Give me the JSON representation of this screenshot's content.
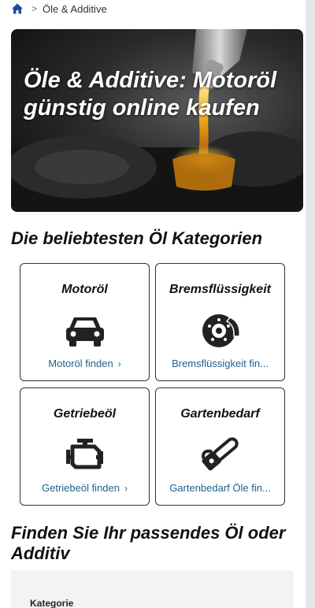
{
  "breadcrumb": {
    "home_icon": "home-icon",
    "separator": ">",
    "current": "Öle & Additive"
  },
  "hero": {
    "title": "Öle & Additive: Motoröl günstig online kaufen"
  },
  "categories_section": {
    "title": "Die beliebtesten Öl Kategorien"
  },
  "categories": [
    {
      "title": "Motoröl",
      "icon": "car-icon",
      "link": "Motoröl finden",
      "chevron": "›"
    },
    {
      "title": "Bremsflüssigkeit",
      "icon": "brake-disc-icon",
      "link": "Bremsflüssigkeit fin...",
      "chevron": ""
    },
    {
      "title": "Getriebeöl",
      "icon": "engine-icon",
      "link": "Getriebeöl finden",
      "chevron": "›"
    },
    {
      "title": "Gartenbedarf",
      "icon": "chainsaw-icon",
      "link": "Gartenbedarf Öle fin...",
      "chevron": ""
    }
  ],
  "finder_section": {
    "title": "Finden Sie Ihr passendes Öl oder Additiv"
  },
  "filter": {
    "label": "Kategorie"
  },
  "colors": {
    "link": "#1f5f8b",
    "home_icon": "#1f4e99"
  }
}
